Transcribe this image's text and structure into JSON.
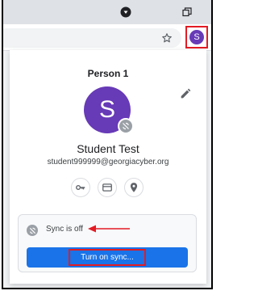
{
  "titlebar": {
    "media_icon": "media-control-icon",
    "restore_icon": "restore-window-icon"
  },
  "toolbar": {
    "bookmark_icon": "star-icon",
    "profile_initial": "S"
  },
  "profile_panel": {
    "title": "Person 1",
    "avatar_initial": "S",
    "name": "Student Test",
    "email": "student999999@georgiacyber.org",
    "quick_actions": [
      "key-icon",
      "credit-card-icon",
      "location-pin-icon"
    ],
    "sync": {
      "status_text": "Sync is off",
      "button_label": "Turn on sync..."
    }
  },
  "colors": {
    "accent": "#1a73e8",
    "avatar": "#673ab7",
    "highlight": "#e31b23"
  }
}
